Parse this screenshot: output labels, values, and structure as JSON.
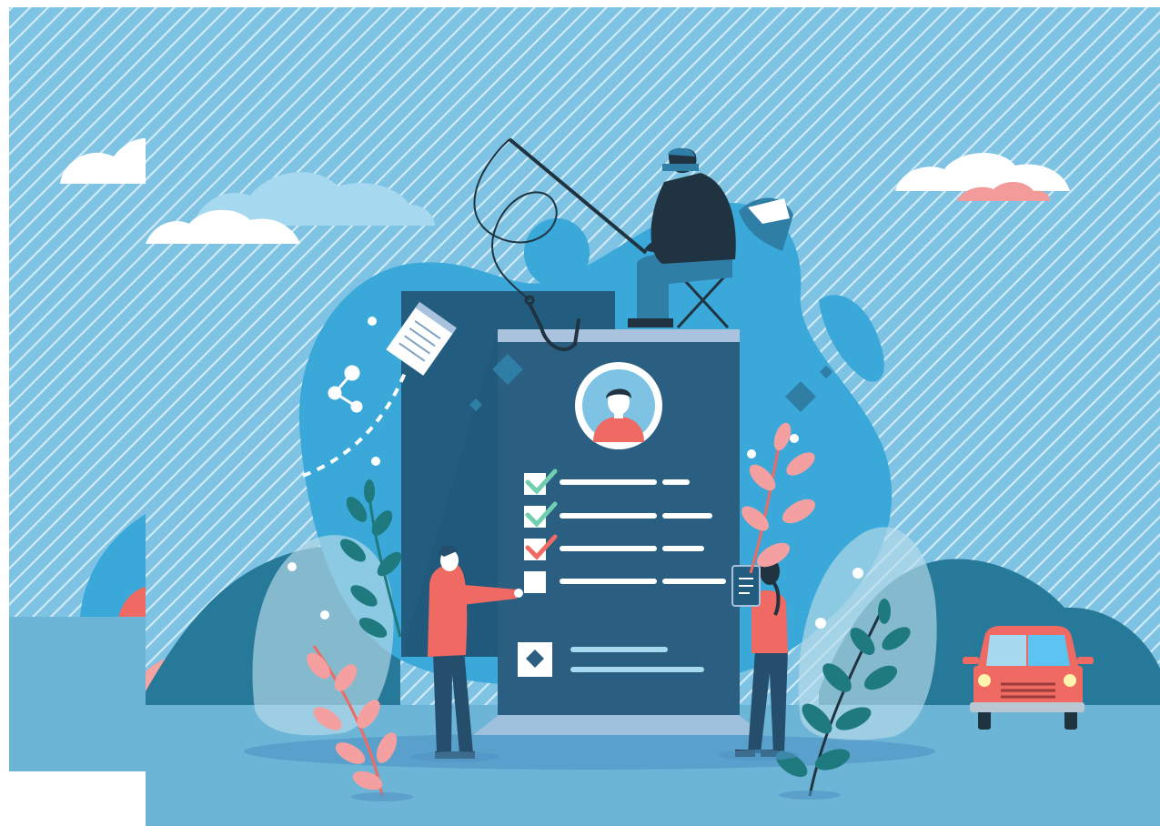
{
  "illustration": {
    "subject": "phishing-resume",
    "palette": {
      "sky": "#7ec3e3",
      "sky_stripe": "#ffffff",
      "ground": "#6db5d6",
      "blob_main": "#3aa8d8",
      "hill_dark": "#27799a",
      "doc_back": "#225d80",
      "doc_front": "#2a5f82",
      "doc_header": "#a9c2dd",
      "accent_red": "#ef6a62",
      "accent_pink": "#f4a0a0",
      "check_green": "#6fcfb0",
      "leaf_teal": "#1f7a80",
      "cloud_white": "#ffffff",
      "cloud_light": "#a6d8ef",
      "person_pants": "#254e6d",
      "hacker_body": "#1f3440"
    },
    "checklist": [
      {
        "status": "checked",
        "mark_color": "#6fcfb0"
      },
      {
        "status": "checked",
        "mark_color": "#6fcfb0"
      },
      {
        "status": "checked",
        "mark_color": "#ef6a62"
      },
      {
        "status": "empty",
        "mark_color": "#ffffff"
      }
    ],
    "icons": [
      "resume-document",
      "avatar-portrait",
      "fishing-hook",
      "notepad",
      "share-nodes",
      "car",
      "leaf-branch"
    ]
  }
}
